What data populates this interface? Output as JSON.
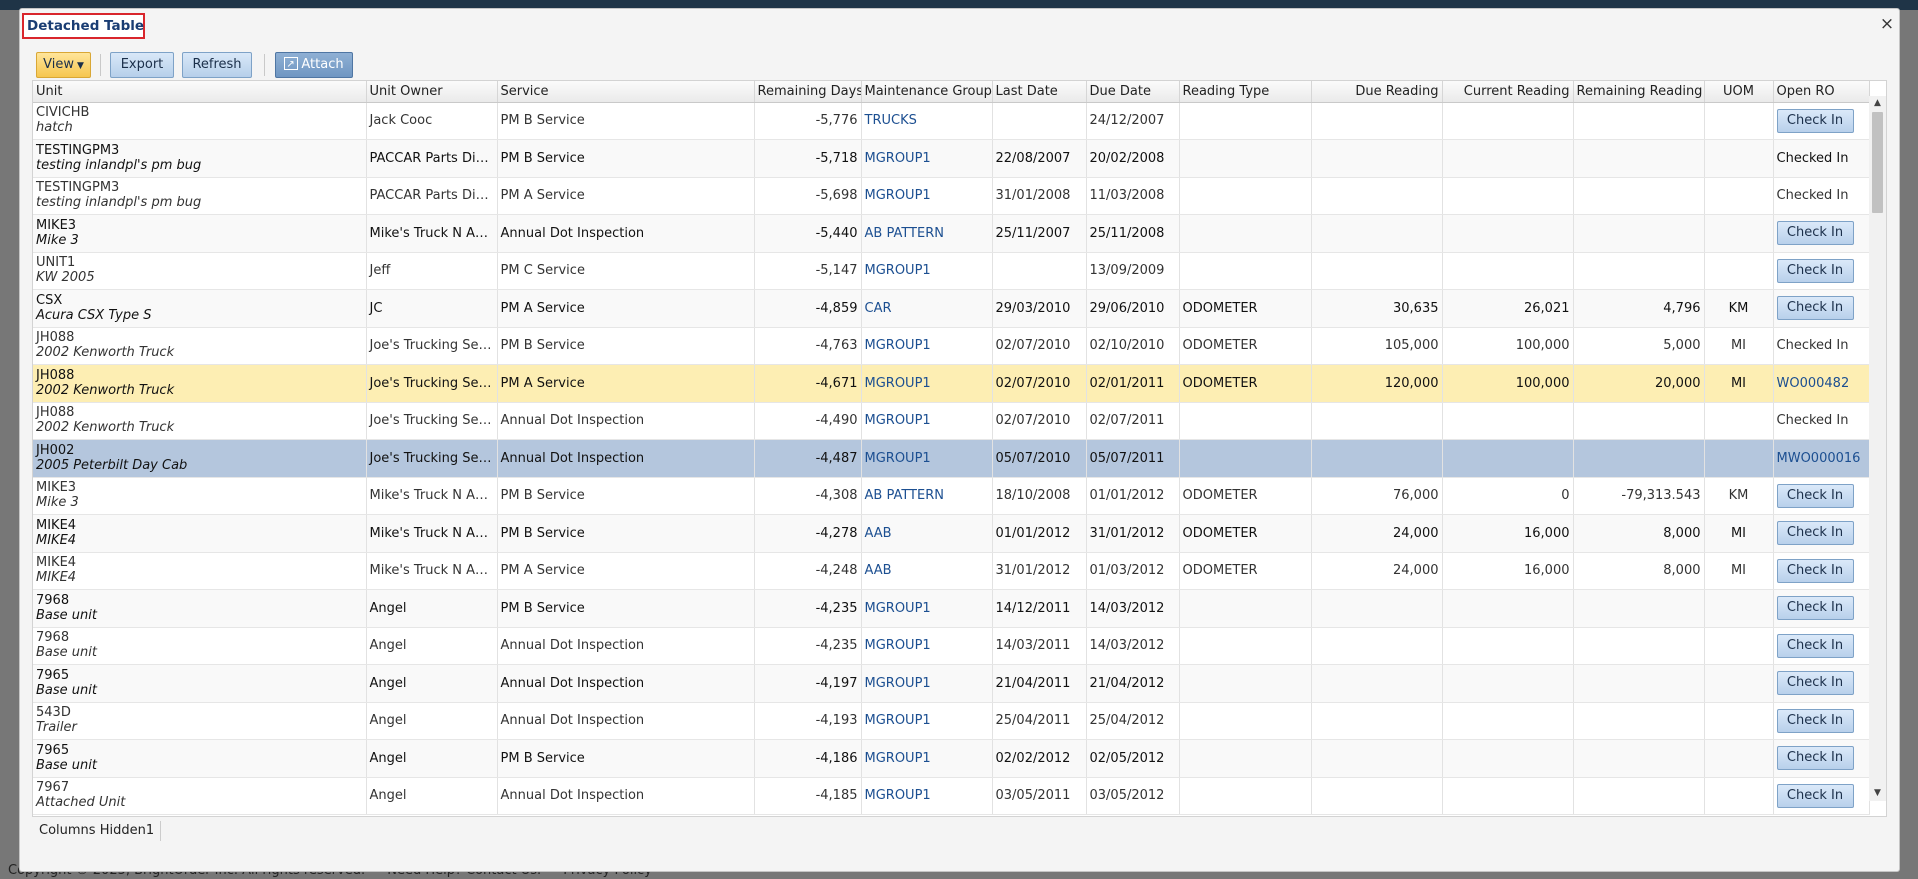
{
  "background": {
    "footer": [
      "Copyright © 2025, BrightOrder Inc. All rights reserved.",
      "Need Help? Contact Us.",
      "Privacy Policy"
    ]
  },
  "modal": {
    "title": "Detached Table",
    "close": "×"
  },
  "toolbar": {
    "view_label": "View",
    "export_label": "Export",
    "refresh_label": "Refresh",
    "attach_label": "Attach"
  },
  "columns": [
    "Unit",
    "Unit Owner",
    "Service",
    "Remaining Days",
    "Maintenance Group",
    "Last Date",
    "Due Date",
    "Reading Type",
    "Due Reading",
    "Current Reading",
    "Remaining Reading",
    "UOM",
    "Open RO"
  ],
  "rows": [
    {
      "unit": "CIVICHB",
      "desc": "hatch",
      "owner": "Jack Cooc",
      "service": "PM B Service",
      "remaining_days": "-5,776",
      "group": "TRUCKS",
      "last_date": "",
      "due_date": "24/12/2007",
      "reading_type": "",
      "due_reading": "",
      "current_reading": "",
      "remaining_reading": "",
      "uom": "",
      "open_ro": "Check In",
      "ro_kind": "button",
      "style": "normal"
    },
    {
      "unit": "TESTINGPM3",
      "desc": "testing inlandpl's pm bug",
      "owner": "PACCAR Parts Divi...",
      "service": "PM B Service",
      "remaining_days": "-5,718",
      "group": "MGROUP1",
      "last_date": "22/08/2007",
      "due_date": "20/02/2008",
      "reading_type": "",
      "due_reading": "",
      "current_reading": "",
      "remaining_reading": "",
      "uom": "",
      "open_ro": "Checked In",
      "ro_kind": "text",
      "style": "bold"
    },
    {
      "unit": "TESTINGPM3",
      "desc": "testing inlandpl's pm bug",
      "owner": "PACCAR Parts Divi...",
      "service": "PM A Service",
      "remaining_days": "-5,698",
      "group": "MGROUP1",
      "last_date": "31/01/2008",
      "due_date": "11/03/2008",
      "reading_type": "",
      "due_reading": "",
      "current_reading": "",
      "remaining_reading": "",
      "uom": "",
      "open_ro": "Checked In",
      "ro_kind": "text",
      "style": "normal"
    },
    {
      "unit": "MIKE3",
      "desc": "Mike 3",
      "owner": "Mike's Truck N Auto",
      "service": "Annual Dot Inspection",
      "remaining_days": "-5,440",
      "group": "AB PATTERN",
      "last_date": "25/11/2007",
      "due_date": "25/11/2008",
      "reading_type": "",
      "due_reading": "",
      "current_reading": "",
      "remaining_reading": "",
      "uom": "",
      "open_ro": "Check In",
      "ro_kind": "button",
      "style": "bold"
    },
    {
      "unit": "UNIT1",
      "desc": "KW 2005",
      "owner": "Jeff",
      "service": "PM C Service",
      "remaining_days": "-5,147",
      "group": "MGROUP1",
      "last_date": "",
      "due_date": "13/09/2009",
      "reading_type": "",
      "due_reading": "",
      "current_reading": "",
      "remaining_reading": "",
      "uom": "",
      "open_ro": "Check In",
      "ro_kind": "button",
      "style": "normal"
    },
    {
      "unit": "CSX",
      "desc": "Acura CSX Type S",
      "owner": "JC",
      "service": "PM A Service",
      "remaining_days": "-4,859",
      "group": "CAR",
      "last_date": "29/03/2010",
      "due_date": "29/06/2010",
      "reading_type": "ODOMETER",
      "due_reading": "30,635",
      "current_reading": "26,021",
      "remaining_reading": "4,796",
      "uom": "KM",
      "open_ro": "Check In",
      "ro_kind": "button",
      "style": "bold"
    },
    {
      "unit": "JH088",
      "desc": "2002 Kenworth Truck",
      "owner": "Joe's Trucking Ser...",
      "service": "PM B Service",
      "remaining_days": "-4,763",
      "group": "MGROUP1",
      "last_date": "02/07/2010",
      "due_date": "02/10/2010",
      "reading_type": "ODOMETER",
      "due_reading": "105,000",
      "current_reading": "100,000",
      "remaining_reading": "5,000",
      "uom": "MI",
      "open_ro": "Checked In",
      "ro_kind": "text",
      "style": "normal"
    },
    {
      "unit": "JH088",
      "desc": "2002 Kenworth Truck",
      "owner": "Joe's Trucking Ser...",
      "service": "PM A Service",
      "remaining_days": "-4,671",
      "group": "MGROUP1",
      "last_date": "02/07/2010",
      "due_date": "02/01/2011",
      "reading_type": "ODOMETER",
      "due_reading": "120,000",
      "current_reading": "100,000",
      "remaining_reading": "20,000",
      "uom": "MI",
      "open_ro": "WO000482",
      "ro_kind": "link",
      "style": "yellow"
    },
    {
      "unit": "JH088",
      "desc": "2002 Kenworth Truck",
      "owner": "Joe's Trucking Ser...",
      "service": "Annual Dot Inspection",
      "remaining_days": "-4,490",
      "group": "MGROUP1",
      "last_date": "02/07/2010",
      "due_date": "02/07/2011",
      "reading_type": "",
      "due_reading": "",
      "current_reading": "",
      "remaining_reading": "",
      "uom": "",
      "open_ro": "Checked In",
      "ro_kind": "text",
      "style": "normal"
    },
    {
      "unit": "JH002",
      "desc": "2005 Peterbilt Day Cab",
      "owner": "Joe's Trucking Ser...",
      "service": "Annual Dot Inspection",
      "remaining_days": "-4,487",
      "group": "MGROUP1",
      "last_date": "05/07/2010",
      "due_date": "05/07/2011",
      "reading_type": "",
      "due_reading": "",
      "current_reading": "",
      "remaining_reading": "",
      "uom": "",
      "open_ro": "MWO000016",
      "ro_kind": "link",
      "style": "blue"
    },
    {
      "unit": "MIKE3",
      "desc": "Mike 3",
      "owner": "Mike's Truck N Auto",
      "service": "PM B Service",
      "remaining_days": "-4,308",
      "group": "AB PATTERN",
      "last_date": "18/10/2008",
      "due_date": "01/01/2012",
      "reading_type": "ODOMETER",
      "due_reading": "76,000",
      "current_reading": "0",
      "remaining_reading": "-79,313.543",
      "uom": "KM",
      "open_ro": "Check In",
      "ro_kind": "button",
      "style": "normal"
    },
    {
      "unit": "MIKE4",
      "desc": "MIKE4",
      "owner": "Mike's Truck N Auto",
      "service": "PM B Service",
      "remaining_days": "-4,278",
      "group": "AAB",
      "last_date": "01/01/2012",
      "due_date": "31/01/2012",
      "reading_type": "ODOMETER",
      "due_reading": "24,000",
      "current_reading": "16,000",
      "remaining_reading": "8,000",
      "uom": "MI",
      "open_ro": "Check In",
      "ro_kind": "button",
      "style": "bold"
    },
    {
      "unit": "MIKE4",
      "desc": "MIKE4",
      "owner": "Mike's Truck N Auto",
      "service": "PM A Service",
      "remaining_days": "-4,248",
      "group": "AAB",
      "last_date": "31/01/2012",
      "due_date": "01/03/2012",
      "reading_type": "ODOMETER",
      "due_reading": "24,000",
      "current_reading": "16,000",
      "remaining_reading": "8,000",
      "uom": "MI",
      "open_ro": "Check In",
      "ro_kind": "button",
      "style": "normal"
    },
    {
      "unit": "7968",
      "desc": "Base unit",
      "owner": "Angel",
      "service": "PM B Service",
      "remaining_days": "-4,235",
      "group": "MGROUP1",
      "last_date": "14/12/2011",
      "due_date": "14/03/2012",
      "reading_type": "",
      "due_reading": "",
      "current_reading": "",
      "remaining_reading": "",
      "uom": "",
      "open_ro": "Check In",
      "ro_kind": "button",
      "style": "bold"
    },
    {
      "unit": "7968",
      "desc": "Base unit",
      "owner": "Angel",
      "service": "Annual Dot Inspection",
      "remaining_days": "-4,235",
      "group": "MGROUP1",
      "last_date": "14/03/2011",
      "due_date": "14/03/2012",
      "reading_type": "",
      "due_reading": "",
      "current_reading": "",
      "remaining_reading": "",
      "uom": "",
      "open_ro": "Check In",
      "ro_kind": "button",
      "style": "normal"
    },
    {
      "unit": "7965",
      "desc": "Base unit",
      "owner": "Angel",
      "service": "Annual Dot Inspection",
      "remaining_days": "-4,197",
      "group": "MGROUP1",
      "last_date": "21/04/2011",
      "due_date": "21/04/2012",
      "reading_type": "",
      "due_reading": "",
      "current_reading": "",
      "remaining_reading": "",
      "uom": "",
      "open_ro": "Check In",
      "ro_kind": "button",
      "style": "bold"
    },
    {
      "unit": "543D",
      "desc": "Trailer",
      "owner": "Angel",
      "service": "Annual Dot Inspection",
      "remaining_days": "-4,193",
      "group": "MGROUP1",
      "last_date": "25/04/2011",
      "due_date": "25/04/2012",
      "reading_type": "",
      "due_reading": "",
      "current_reading": "",
      "remaining_reading": "",
      "uom": "",
      "open_ro": "Check In",
      "ro_kind": "button",
      "style": "normal"
    },
    {
      "unit": "7965",
      "desc": "Base unit",
      "owner": "Angel",
      "service": "PM B Service",
      "remaining_days": "-4,186",
      "group": "MGROUP1",
      "last_date": "02/02/2012",
      "due_date": "02/05/2012",
      "reading_type": "",
      "due_reading": "",
      "current_reading": "",
      "remaining_reading": "",
      "uom": "",
      "open_ro": "Check In",
      "ro_kind": "button",
      "style": "bold"
    },
    {
      "unit": "7967",
      "desc": "Attached Unit",
      "owner": "Angel",
      "service": "Annual Dot Inspection",
      "remaining_days": "-4,185",
      "group": "MGROUP1",
      "last_date": "03/05/2011",
      "due_date": "03/05/2012",
      "reading_type": "",
      "due_reading": "",
      "current_reading": "",
      "remaining_reading": "",
      "uom": "",
      "open_ro": "Check In",
      "ro_kind": "button",
      "style": "normal"
    }
  ],
  "status": {
    "columns_hidden": "Columns Hidden1"
  },
  "colors": {
    "header_bar": "#1f3447",
    "title_border": "#d9262c",
    "link": "#1c4f91",
    "highlight_yellow": "#fdeeb3",
    "highlight_blue": "#b4c6dd"
  },
  "icons": {
    "view_dropdown": "caret-down-icon",
    "attach": "attach-icon",
    "close": "close-icon"
  }
}
